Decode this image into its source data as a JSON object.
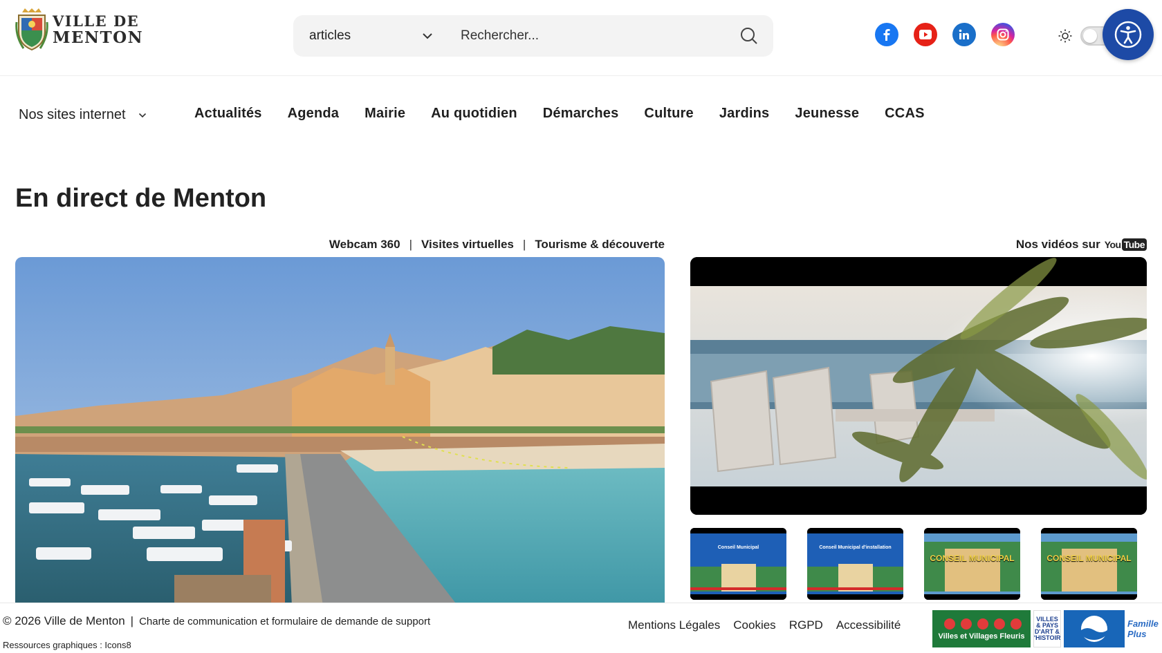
{
  "header": {
    "logo": {
      "line1": "VILLE DE",
      "line2": "MENTON"
    },
    "search": {
      "category": "articles",
      "placeholder": "Rechercher..."
    },
    "socials": [
      {
        "name": "facebook",
        "color": "#1877f2"
      },
      {
        "name": "youtube",
        "color": "#e62117"
      },
      {
        "name": "linkedin",
        "color": "#1a6fc9"
      },
      {
        "name": "instagram",
        "color": "#d6249f"
      }
    ],
    "accent_color": "#1d4aa6"
  },
  "nav": {
    "sites_label": "Nos sites internet",
    "items": [
      "Actualités",
      "Agenda",
      "Mairie",
      "Au quotidien",
      "Démarches",
      "Culture",
      "Jardins",
      "Jeunesse",
      "CCAS"
    ]
  },
  "main": {
    "title": "En direct de Menton",
    "webcam_links": [
      "Webcam 360",
      "Visites virtuelles",
      "Tourisme & découverte"
    ],
    "videos_label": "Nos vidéos sur",
    "youtube_logo": {
      "you": "You",
      "tube": "Tube"
    },
    "thumbnails": [
      {
        "line1": "Conseil Municipal",
        "line2": ""
      },
      {
        "line1": "Conseil Municipal d'installation",
        "line2": ""
      },
      {
        "line1": "",
        "line2": "CONSEIL MUNICIPAL"
      },
      {
        "line1": "",
        "line2": "CONSEIL MUNICIPAL"
      }
    ]
  },
  "footer": {
    "copyright": "© 2026 Ville de Menton",
    "charte": "Charte de communication et formulaire de demande de support",
    "resources": "Ressources graphiques : Icons8",
    "links": [
      "Mentions Légales",
      "Cookies",
      "RGPD",
      "Accessibilité"
    ],
    "labels": {
      "vvf": "Villes et Villages Fleuris",
      "vpah": [
        "VILLES",
        "& PAYS",
        "D'ART &",
        "D'HISTOIRE"
      ],
      "famille": "Famille Plus"
    }
  }
}
